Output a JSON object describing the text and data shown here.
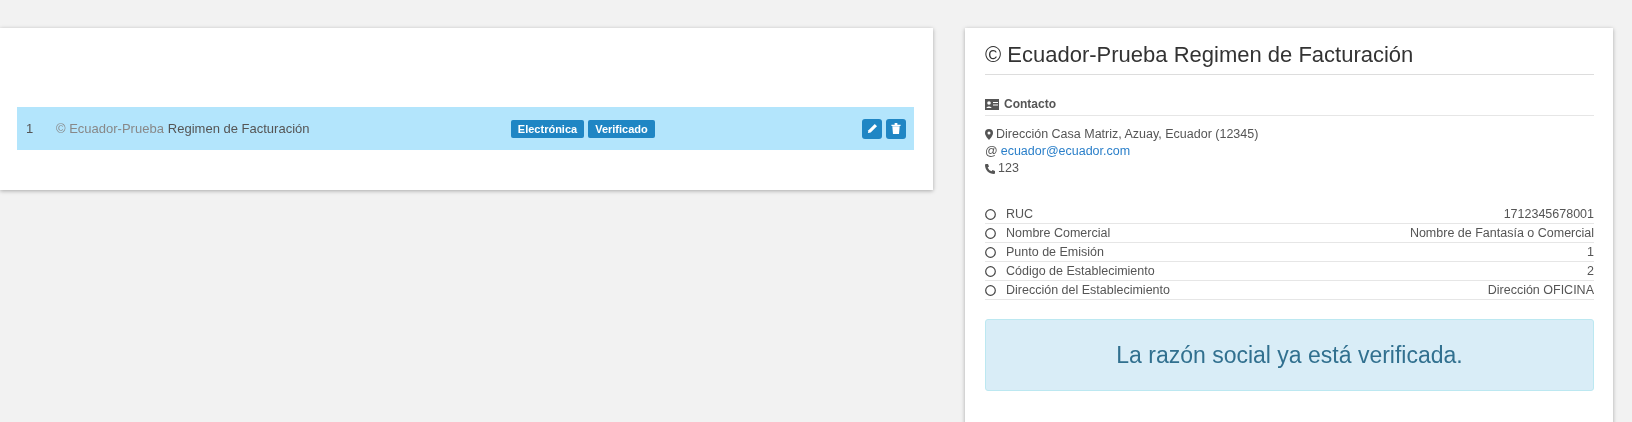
{
  "table": {
    "rows": [
      {
        "number": "1",
        "prefix": "© Ecuador-Prueba",
        "name": "Regimen de Facturación",
        "badges": [
          "Electrónica",
          "Verificado"
        ],
        "selected": true
      }
    ]
  },
  "detail": {
    "title": "© Ecuador-Prueba Regimen de Facturación",
    "contact_heading": "Contacto",
    "address": "Dirección Casa Matriz, Azuay, Ecuador (12345)",
    "email_prefix": "@",
    "email": "ecuador@ecuador.com",
    "phone": "123",
    "fields": [
      {
        "label": "RUC",
        "value": "1712345678001"
      },
      {
        "label": "Nombre Comercial",
        "value": "Nombre de Fantasía o Comercial"
      },
      {
        "label": "Punto de Emisión",
        "value": "1"
      },
      {
        "label": "Código de Establecimiento",
        "value": "2"
      },
      {
        "label": "Dirección del Establecimiento",
        "value": "Dirección OFICINA"
      }
    ],
    "alert": "La razón social ya está verificada."
  }
}
